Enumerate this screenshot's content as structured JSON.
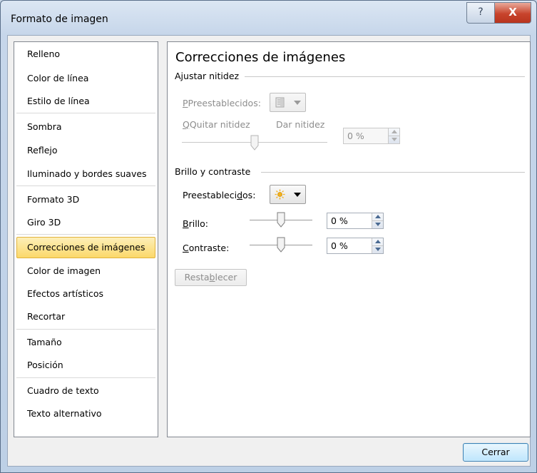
{
  "window": {
    "title": "Formato de imagen",
    "help_glyph": "?",
    "close_glyph": "X"
  },
  "sidebar": {
    "items": [
      {
        "label": "Relleno",
        "selected": false
      },
      {
        "label": "Color de línea",
        "selected": false
      },
      {
        "label": "Estilo de línea",
        "selected": false
      },
      {
        "label": "Sombra",
        "selected": false
      },
      {
        "label": "Reflejo",
        "selected": false
      },
      {
        "label": "Iluminado y bordes suaves",
        "selected": false
      },
      {
        "label": "Formato 3D",
        "selected": false
      },
      {
        "label": "Giro 3D",
        "selected": false
      },
      {
        "label": "Correcciones de imágenes",
        "selected": true
      },
      {
        "label": "Color de imagen",
        "selected": false
      },
      {
        "label": "Efectos artísticos",
        "selected": false
      },
      {
        "label": "Recortar",
        "selected": false
      },
      {
        "label": "Tamaño",
        "selected": false
      },
      {
        "label": "Posición",
        "selected": false
      },
      {
        "label": "Cuadro de texto",
        "selected": false
      },
      {
        "label": "Texto alternativo",
        "selected": false
      }
    ]
  },
  "main": {
    "heading": "Correcciones de imágenes",
    "sharpness": {
      "section_title": "Ajustar nitidez",
      "presets_label": "Preestablecidos:",
      "soften_label": "Quitar nitidez",
      "sharpen_label": "Dar nitidez",
      "value": "0 %",
      "slider_level": 0.5,
      "enabled": false
    },
    "brightness_contrast": {
      "section_title": "Brillo y contraste",
      "presets_label_a": "Preestableci",
      "presets_label_u": "d",
      "presets_label_b": "os:",
      "brightness_label_u": "B",
      "brightness_label_rest": "rillo:",
      "brightness_value": "0 %",
      "brightness_level": 0.5,
      "contrast_label_u": "C",
      "contrast_label_rest": "ontraste:",
      "contrast_value": "0 %",
      "contrast_level": 0.5
    },
    "reset_a": "Resta",
    "reset_u": "b",
    "reset_b": "lecer"
  },
  "footer": {
    "close_label": "Cerrar"
  },
  "colors": {
    "selected_item_bg": "#fbd86a",
    "selected_item_border": "#e2b33c",
    "close_button_red": "#c8442c",
    "disabled_text": "#8d8d8d"
  },
  "icons": {
    "sharpness_preset": "sharpness-preset-icon",
    "brightness_preset": "sun-icon"
  }
}
